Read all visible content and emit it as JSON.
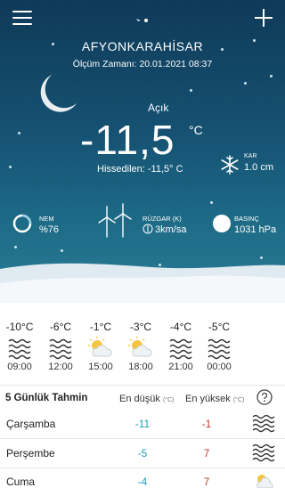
{
  "header": {
    "city": "AFYONKARAHİSAR",
    "measured_label": "Ölçüm Zamanı: 20.01.2021 08:37"
  },
  "current": {
    "condition": "Açık",
    "temperature": "-11,5",
    "unit": "°C",
    "feels_label": "Hissedilen:",
    "feels_value": "-11,5° C",
    "snow_label": "KAR",
    "snow_value": "1.0 cm",
    "humidity_label": "NEM",
    "humidity_value": "%76",
    "wind_label": "RÜZGAR (K)",
    "wind_value": "3km/sa",
    "pressure_label": "BASINÇ",
    "pressure_value": "1031 hPa"
  },
  "hourly": [
    {
      "temp": "-10°C",
      "time": "09:00",
      "icon": "fog-icon"
    },
    {
      "temp": "-6°C",
      "time": "12:00",
      "icon": "fog-icon"
    },
    {
      "temp": "-1°C",
      "time": "15:00",
      "icon": "partly-cloudy-icon"
    },
    {
      "temp": "-3°C",
      "time": "18:00",
      "icon": "partly-cloudy-icon"
    },
    {
      "temp": "-4°C",
      "time": "21:00",
      "icon": "fog-icon"
    },
    {
      "temp": "-5°C",
      "time": "00:00",
      "icon": "fog-icon"
    }
  ],
  "forecast": {
    "title": "5 Günlük Tahmin",
    "low_label": "En düşük",
    "high_label": "En yüksek",
    "unit_label": "(°C)",
    "days": [
      {
        "day": "Çarşamba",
        "low": "-11",
        "high": "-1",
        "icon": "fog-icon"
      },
      {
        "day": "Perşembe",
        "low": "-5",
        "high": "7",
        "icon": "fog-icon"
      },
      {
        "day": "Cuma",
        "low": "-4",
        "high": "7",
        "icon": "partly-cloudy-icon"
      }
    ]
  },
  "colors": {
    "sky_top": "#0f3a58",
    "sky_bottom": "#2a7d96",
    "low_temp": "#1e9fb8",
    "high_temp": "#c5382d"
  }
}
